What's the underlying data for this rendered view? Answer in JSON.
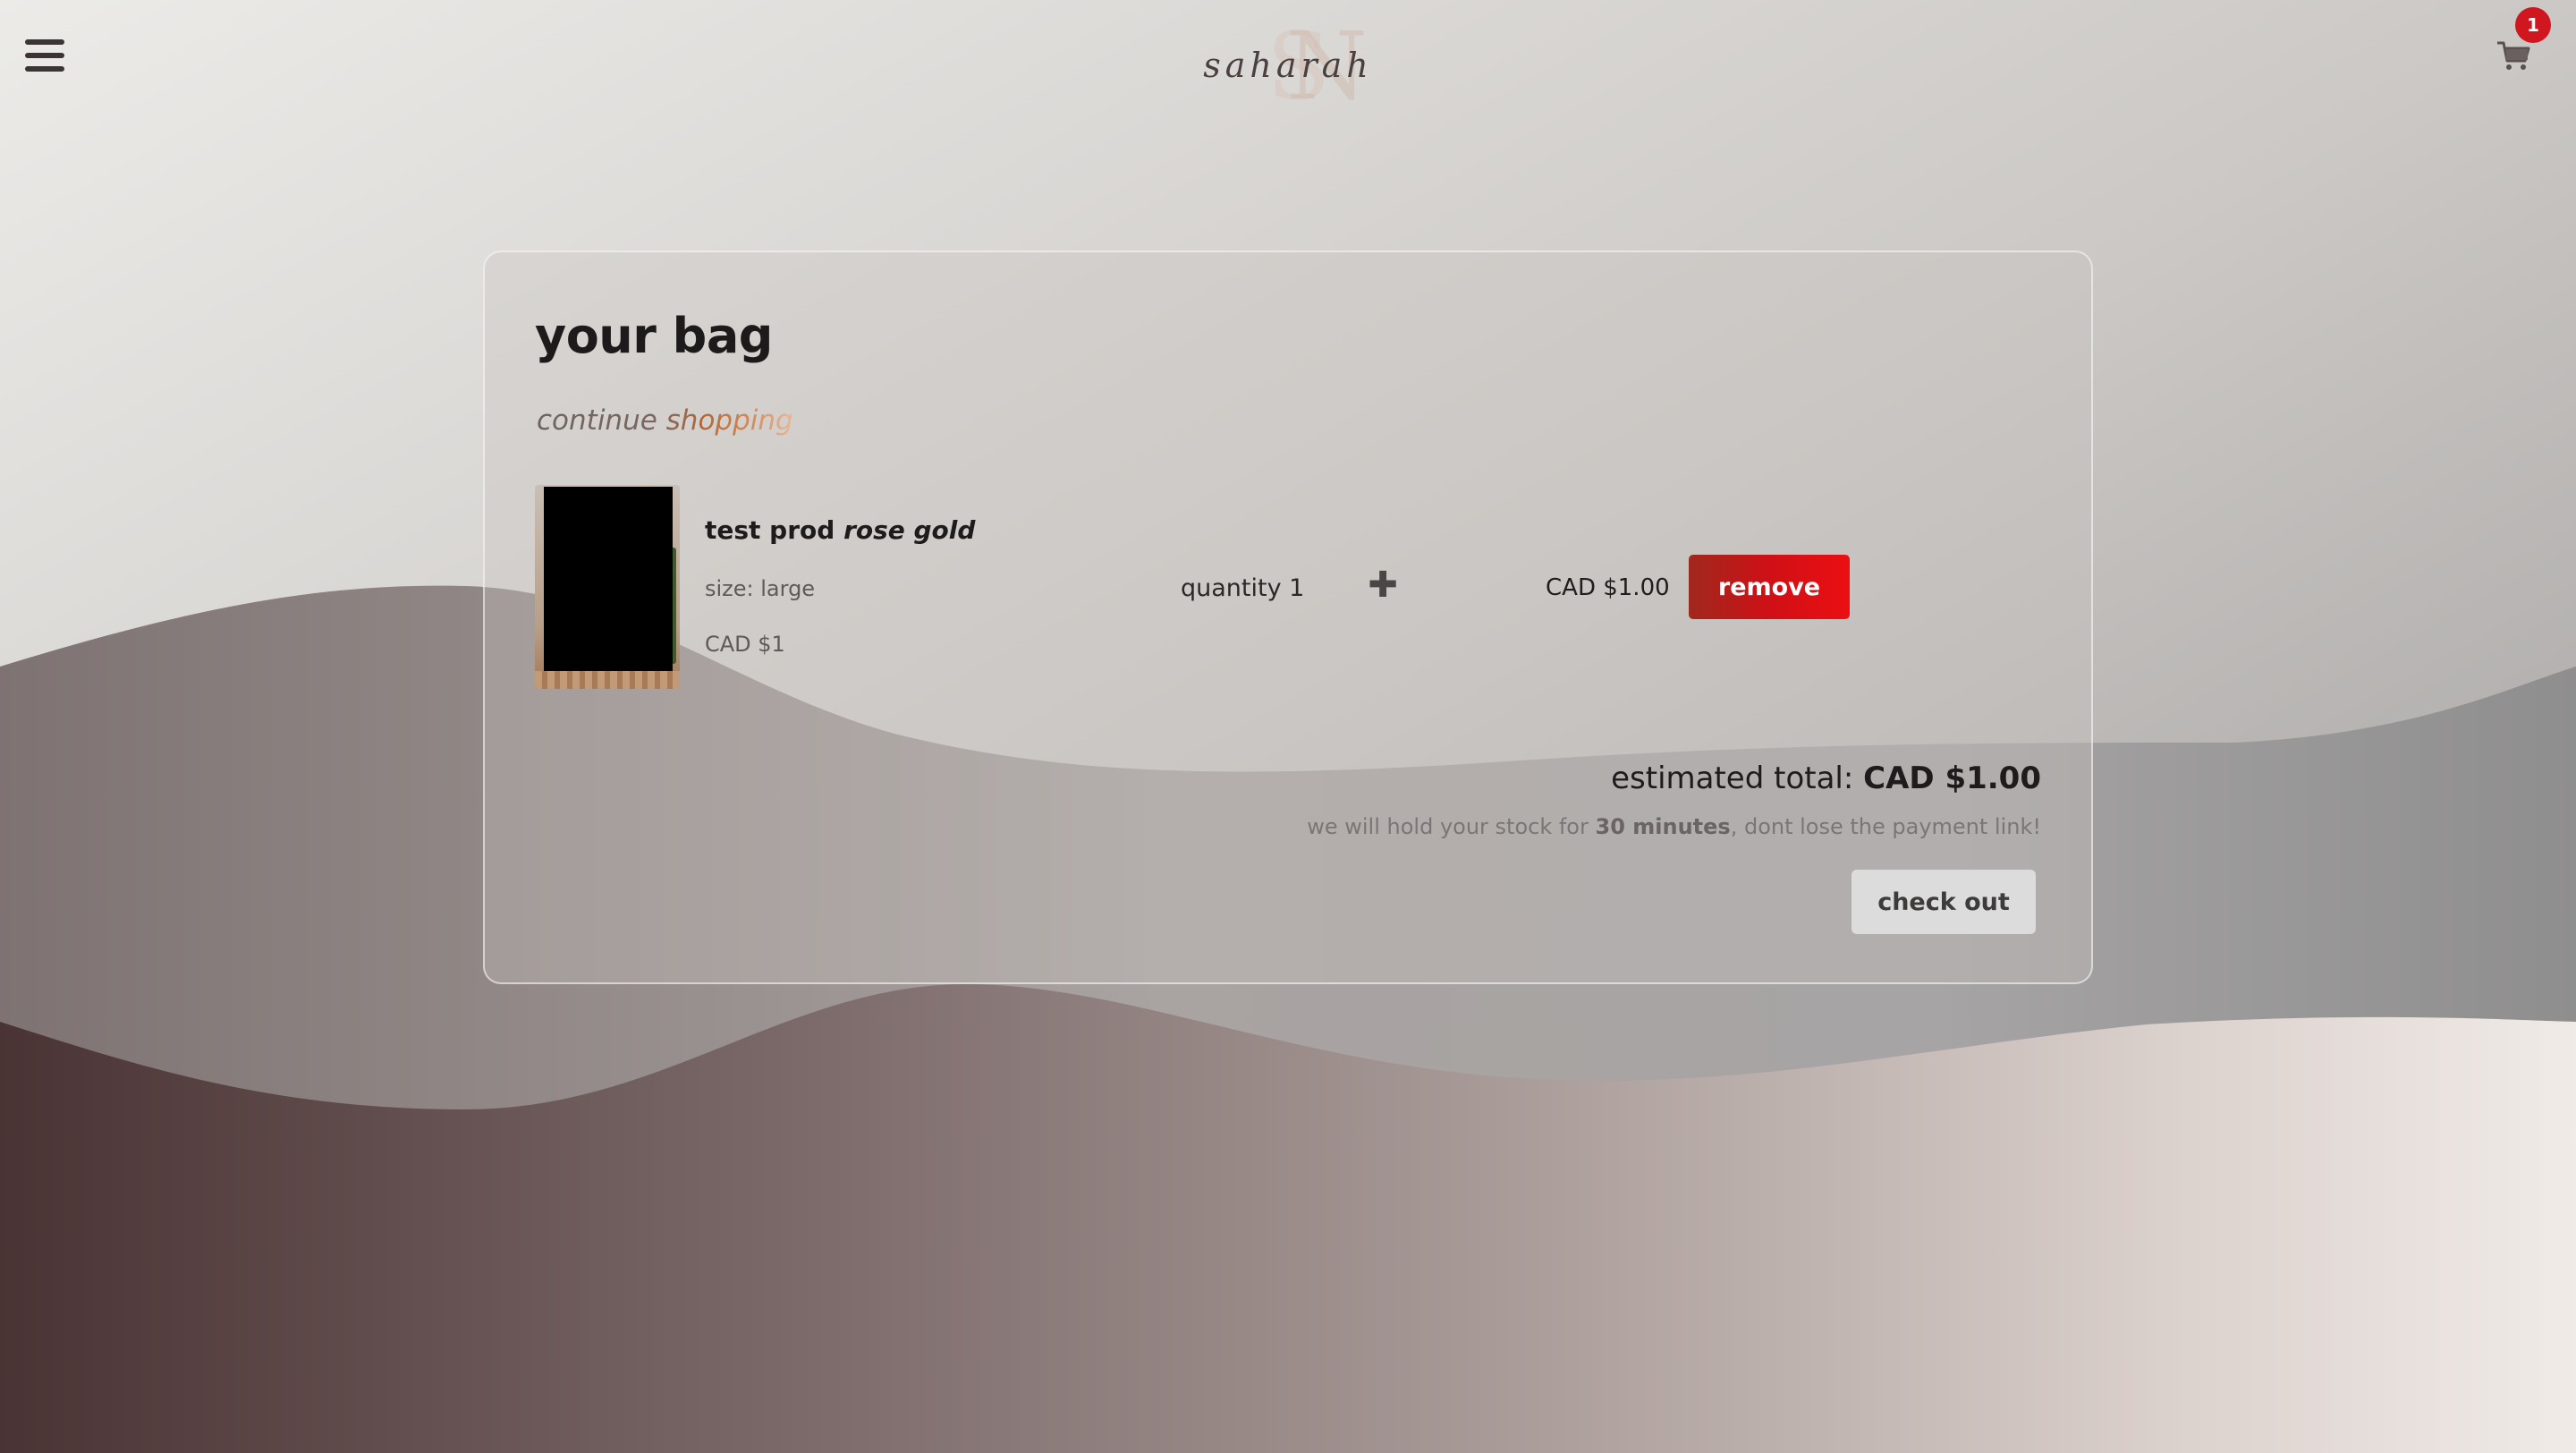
{
  "header": {
    "menu_icon": "hamburger-menu-icon",
    "logo_text": "saharah",
    "logo_monogram": "SN",
    "cart_icon": "shopping-cart-icon",
    "cart_count": "1"
  },
  "bag": {
    "title": "your bag",
    "continue_label": "continue shopping",
    "items": [
      {
        "name": "test prod",
        "variant": "rose gold",
        "size_label": "size: large",
        "unit_price": "CAD $1",
        "quantity_label": "quantity 1",
        "increase_icon": "plus-icon",
        "line_total": "CAD $1.00",
        "remove_label": "remove"
      }
    ],
    "estimated_total_label": "estimated total:",
    "estimated_total_value": "CAD $1.00",
    "hold_note_prefix": "we will hold your stock for",
    "hold_note_time": "30 minutes",
    "hold_note_suffix": ", dont lose the payment link!",
    "checkout_label": "check out"
  },
  "colors": {
    "remove_button": "#d0161e",
    "badge": "#d0161e",
    "checkout_button": "#dcdcdc",
    "link_accent": "#b0683a"
  }
}
